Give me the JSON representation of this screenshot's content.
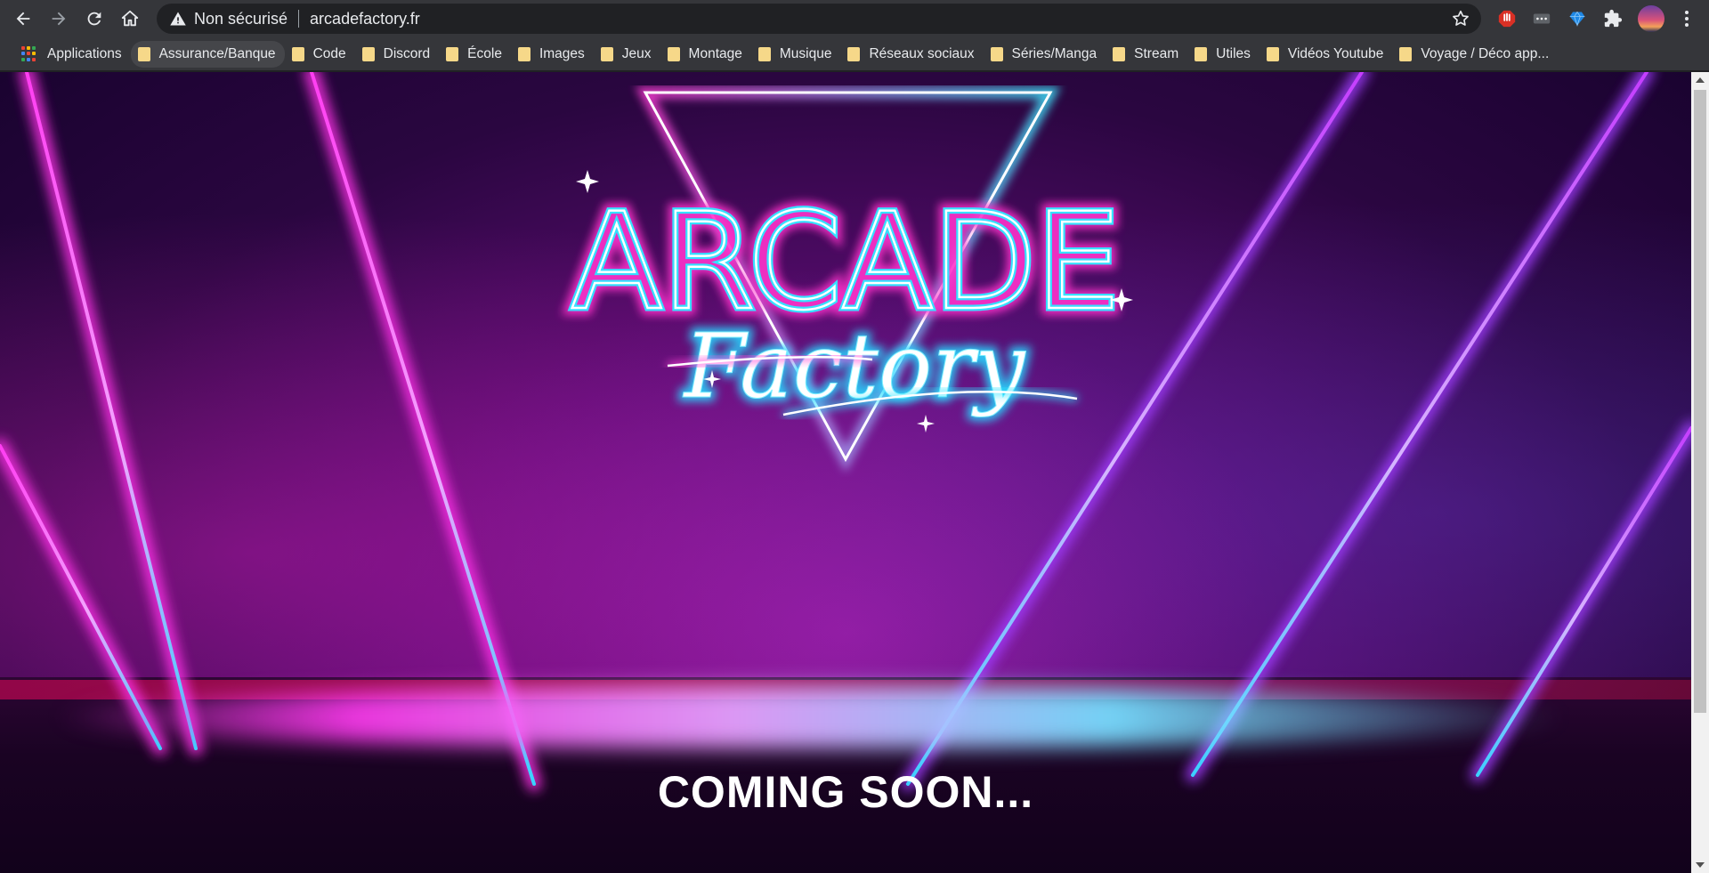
{
  "browser": {
    "security_label": "Non sécurisé",
    "url": "arcadefactory.fr",
    "icons": [
      "back-icon",
      "forward-icon",
      "reload-icon",
      "home-icon",
      "warning-icon",
      "star-icon",
      "adblock-icon",
      "password-icon",
      "gem-icon",
      "puzzle-icon",
      "avatar",
      "menu-icon"
    ]
  },
  "bookmarks": [
    {
      "label": "Applications",
      "type": "apps"
    },
    {
      "label": "Assurance/Banque",
      "type": "folder"
    },
    {
      "label": "Code",
      "type": "folder"
    },
    {
      "label": "Discord",
      "type": "folder"
    },
    {
      "label": "École",
      "type": "folder"
    },
    {
      "label": "Images",
      "type": "folder"
    },
    {
      "label": "Jeux",
      "type": "folder"
    },
    {
      "label": "Montage",
      "type": "folder"
    },
    {
      "label": "Musique",
      "type": "folder"
    },
    {
      "label": "Réseaux sociaux",
      "type": "folder"
    },
    {
      "label": "Séries/Manga",
      "type": "folder"
    },
    {
      "label": "Stream",
      "type": "folder"
    },
    {
      "label": "Utiles",
      "type": "folder"
    },
    {
      "label": "Vidéos Youtube",
      "type": "folder"
    },
    {
      "label": "Voyage / Déco app...",
      "type": "folder"
    }
  ],
  "page": {
    "logo_main": "ARCADE",
    "logo_script": "Factory",
    "tagline": "COMING SOON...",
    "colors": {
      "neon_pink": "#ff2fd0",
      "neon_cyan": "#2fe6ff",
      "bg_purple": "#5b0c72"
    }
  }
}
